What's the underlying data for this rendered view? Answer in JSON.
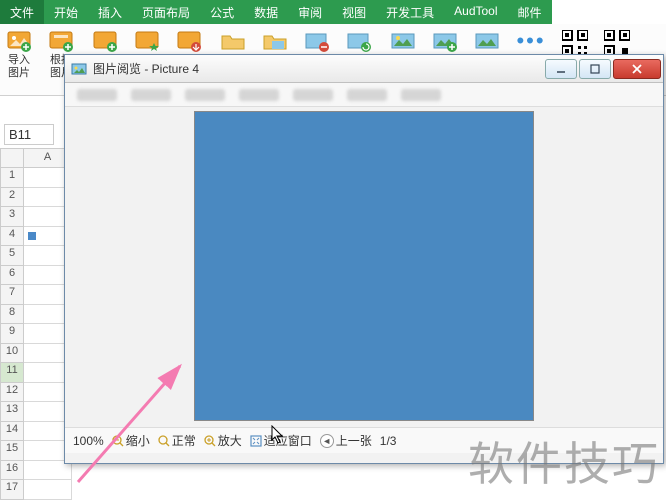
{
  "ribbon": {
    "tabs": [
      "文件",
      "开始",
      "插入",
      "页面布局",
      "公式",
      "数据",
      "审阅",
      "视图",
      "开发工具",
      "AudTool",
      "邮件"
    ]
  },
  "toolbar": {
    "btn1": "导入\n图片",
    "btn2": "根据\n图片"
  },
  "cell_reference": "B11",
  "sheet": {
    "columns": [
      "A"
    ],
    "rows": [
      "1",
      "2",
      "3",
      "4",
      "5",
      "6",
      "7",
      "8",
      "9",
      "10",
      "11",
      "12",
      "13",
      "14",
      "15",
      "16",
      "17"
    ],
    "selected_row": "11"
  },
  "viewer": {
    "title": "图片阅览 - Picture 4",
    "status": {
      "zoom_pct": "100%",
      "zoom_out": "缩小",
      "normal": "正常",
      "zoom_in": "放大",
      "fit": "适应窗口",
      "prev": "上一张",
      "page": "1/3"
    }
  },
  "watermark": "软件技巧"
}
